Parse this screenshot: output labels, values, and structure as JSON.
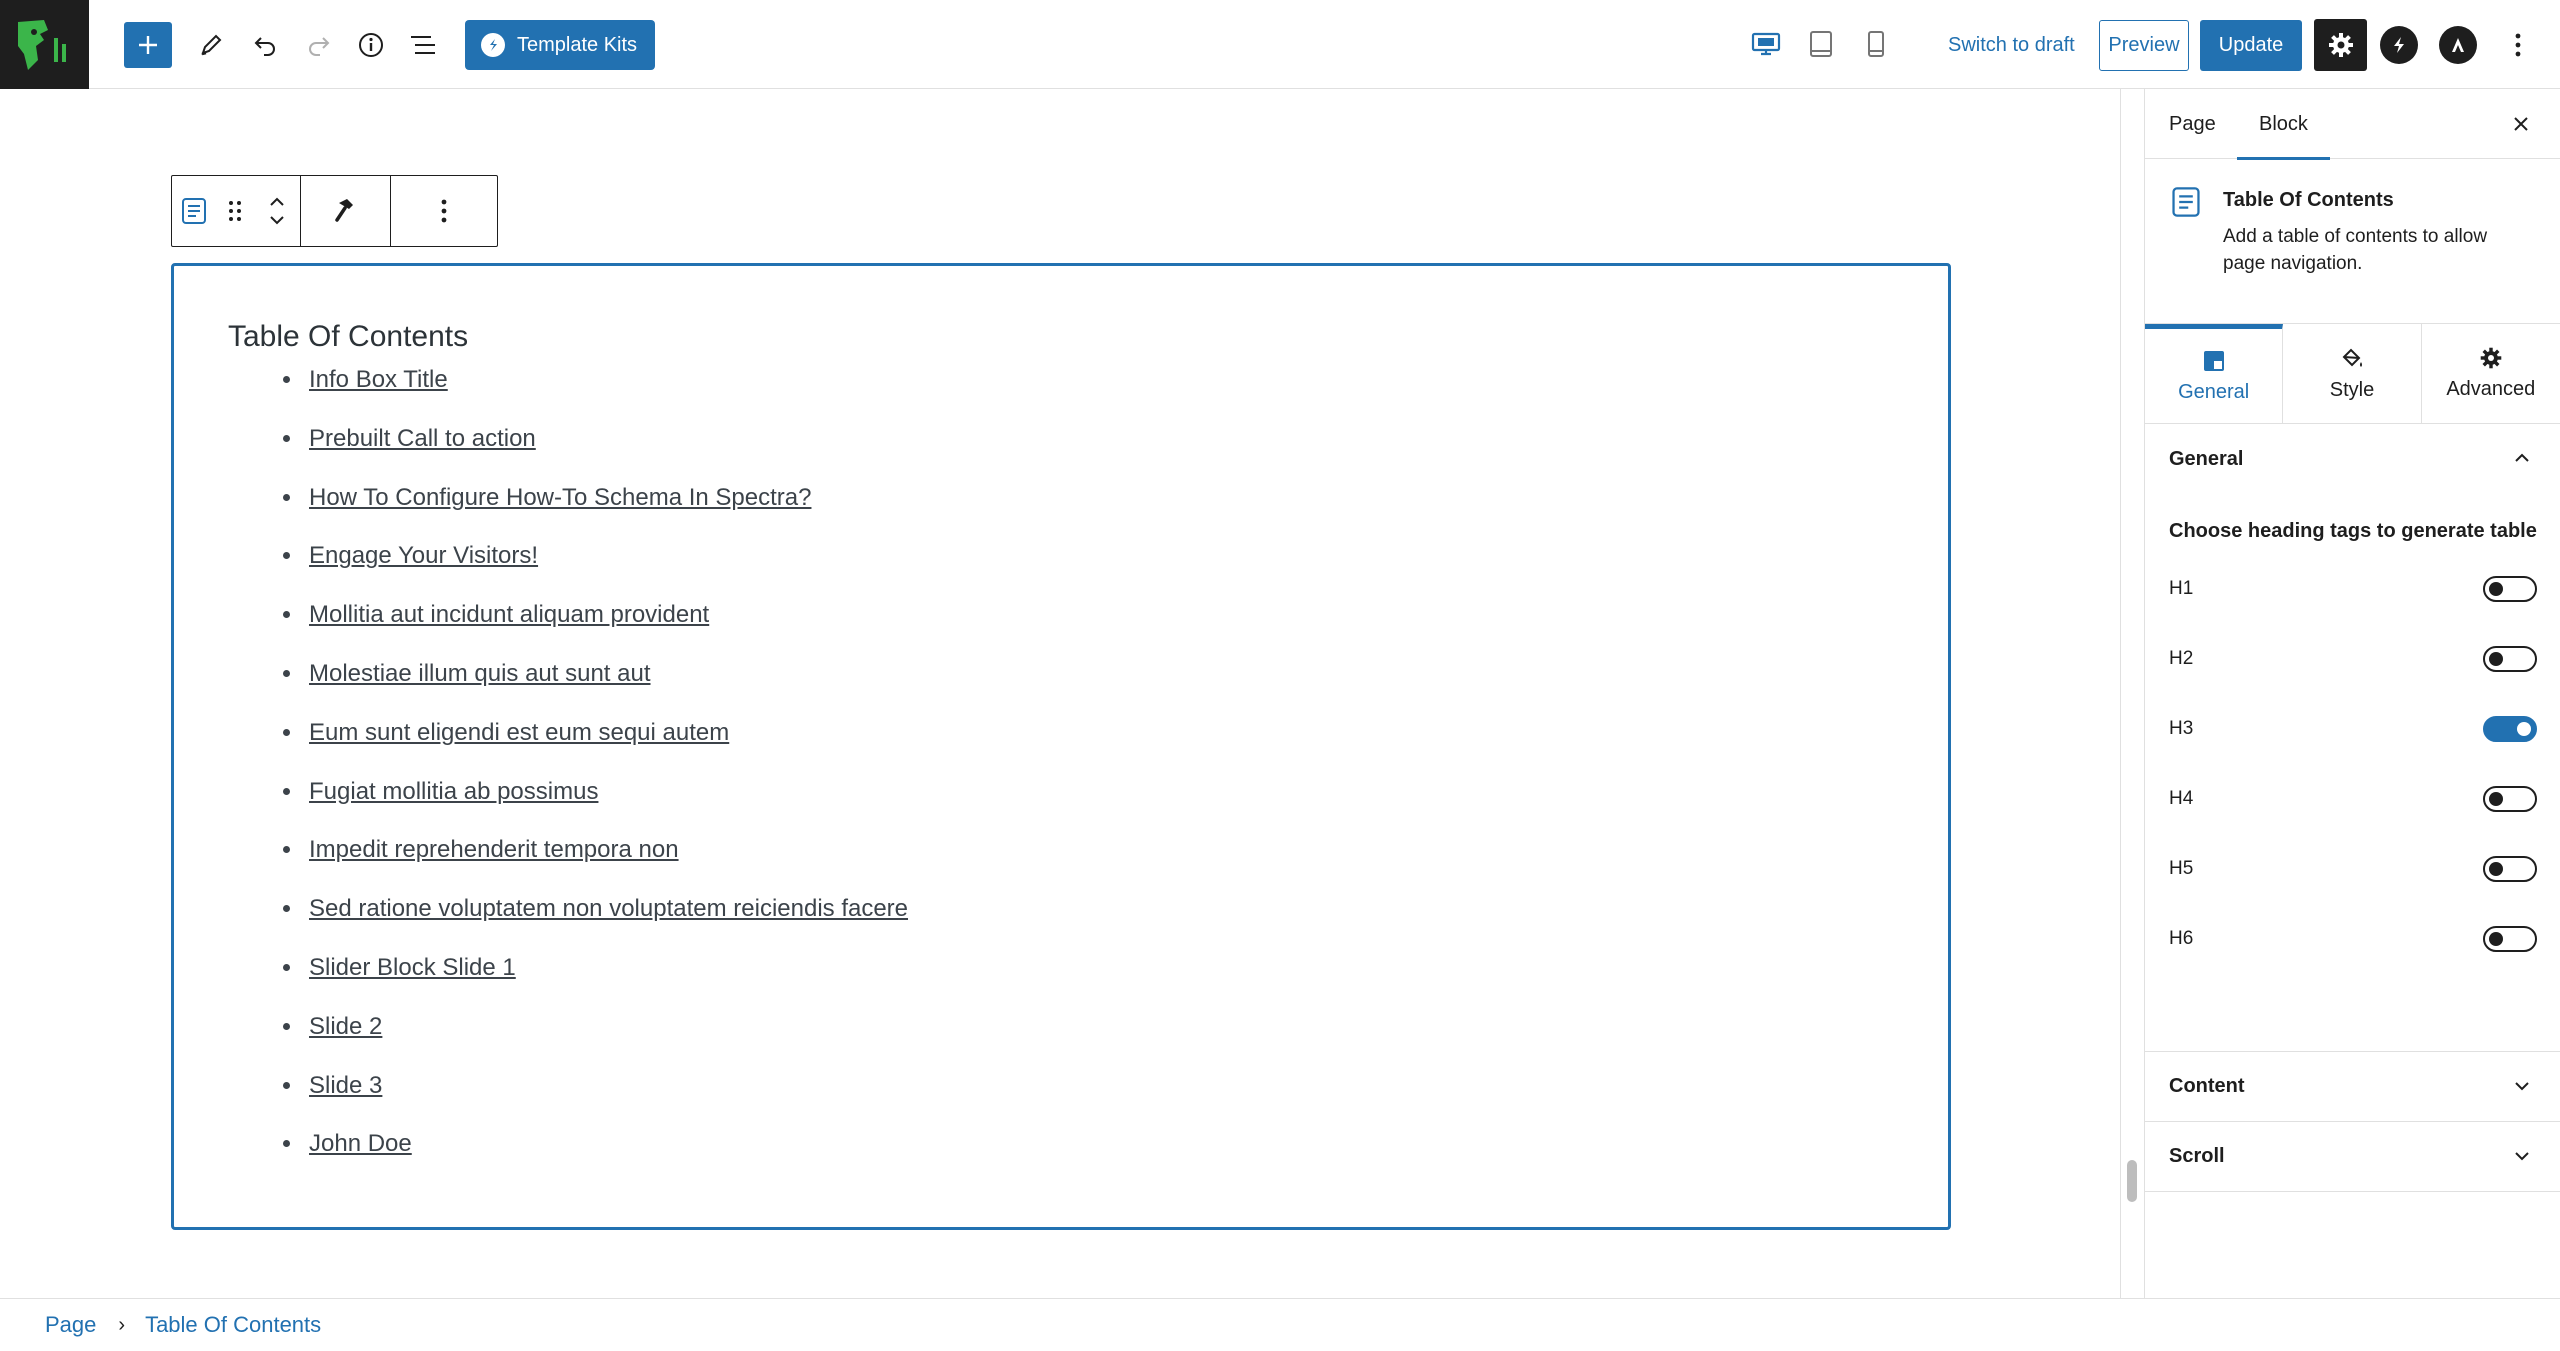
{
  "header": {
    "template_kits_label": "Template Kits",
    "switch_to_draft": "Switch to draft",
    "preview": "Preview",
    "update": "Update"
  },
  "block_toolbar": {
    "icons": [
      "table-of-contents-icon",
      "drag-handle-icon",
      "move-up-down-icon",
      "hammer-icon",
      "more-options-icon"
    ]
  },
  "toc": {
    "title": "Table Of Contents",
    "items": [
      "Info Box Title",
      "Prebuilt Call to action",
      "How To Configure How-To Schema In Spectra?",
      "Engage Your Visitors!",
      "Mollitia aut incidunt aliquam provident",
      "Molestiae illum quis aut sunt aut",
      "Eum sunt eligendi est eum sequi autem",
      "Fugiat mollitia ab possimus",
      "Impedit reprehenderit tempora non",
      "Sed ratione voluptatem non voluptatem reiciendis facere",
      "Slider Block Slide 1",
      "Slide 2",
      "Slide 3",
      "John Doe"
    ]
  },
  "breadcrumb": {
    "root": "Page",
    "current": "Table Of Contents"
  },
  "sidebar": {
    "tabs": [
      "Page",
      "Block"
    ],
    "active_tab": "Block",
    "block_card": {
      "title": "Table Of Contents",
      "description": "Add a table of contents to allow page navigation."
    },
    "panel_tabs": [
      "General",
      "Style",
      "Advanced"
    ],
    "active_panel_tab": "General",
    "general_section": {
      "title": "General",
      "choose_label": "Choose heading tags to generate table",
      "tags": [
        {
          "label": "H1",
          "on": false
        },
        {
          "label": "H2",
          "on": false
        },
        {
          "label": "H3",
          "on": true
        },
        {
          "label": "H4",
          "on": false
        },
        {
          "label": "H5",
          "on": false
        },
        {
          "label": "H6",
          "on": false
        }
      ]
    },
    "collapsed_sections": [
      "Content",
      "Scroll"
    ]
  },
  "colors": {
    "accent": "#2271b1",
    "dark": "#1e1e1e",
    "logo_green": "#3bb54a"
  }
}
